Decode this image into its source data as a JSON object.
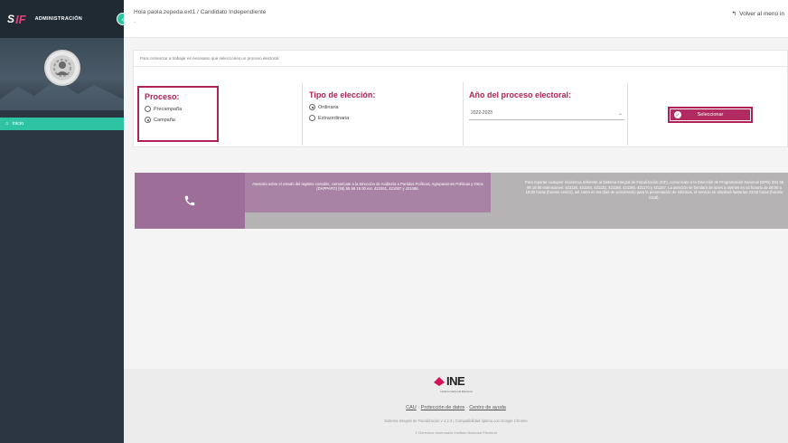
{
  "sidebar": {
    "logo_s": "S",
    "logo_f": "IF",
    "title": "ADMINISTRACIÓN",
    "nav_item": "Inicio"
  },
  "topbar": {
    "greeting": "Hola paola.zepeda.ext1 / Candidato Independiente",
    "subtitle": "-",
    "back_label": "Volver al menú in"
  },
  "main": {
    "instruction": "Para comenzar a trabajar es necesario que selecciones un proceso electoral.",
    "proceso": {
      "title": "Proceso:",
      "options": [
        "Precampaña",
        "Campaña"
      ],
      "selected": "Campaña"
    },
    "tipo": {
      "title": "Tipo de elección:",
      "options": [
        "Ordinaria",
        "Extraordinaria"
      ],
      "selected": "Ordinaria"
    },
    "anio": {
      "title": "Año del proceso electoral:",
      "value": "2022-2023"
    },
    "select_button": "Seleccionar"
  },
  "banner": {
    "mid_text": "Asesoría sobre el estado del registro contable, comunícate a la Dirección de Auditoría a Partidos Políticos, Agrupaciones Políticas y Otros (DAPPAPO) (55) 55 99 16 00 ext. 421061, 421067 y 421068.",
    "right_text": "Para reportar cualquier incidencia referente al Sistema Integral de Fiscalización (SIF), comunícate a la Dirección de Programación Nacional (DPN) (55) 55 99 16 00 extensiones: 423116, 421164, 421132, 421185, 421165, 421170 y 421157. La atención se brindará de lunes a viernes en un horario de 09:00 a 18:00 horas (horario centro), así como en los días de vencimiento para la presentación de informes, el servicio se ampliará hasta las 23:59 horas (horario local).",
    "colors": {
      "phone_bg": "#9c6e98",
      "mid_bg": "#a983a5",
      "right_bg": "#b6b3b5"
    }
  },
  "footer": {
    "logo": "INE",
    "logo_sub": "Instituto Nacional Electoral",
    "link_cau": "CAU",
    "link_privacy": "Protección de datos",
    "link_help": "Centro de ayuda",
    "link_sep": " · ",
    "line1": "Sistema Integral de Fiscalización v 4.2.3 | Compatibilidad óptima con Google Chrome",
    "line2": "© Derechos reservados Instituto Nacional Electoral"
  },
  "colors": {
    "accent": "#2ec4a3",
    "brand": "#b02257",
    "sidebar": "#2b3640"
  }
}
